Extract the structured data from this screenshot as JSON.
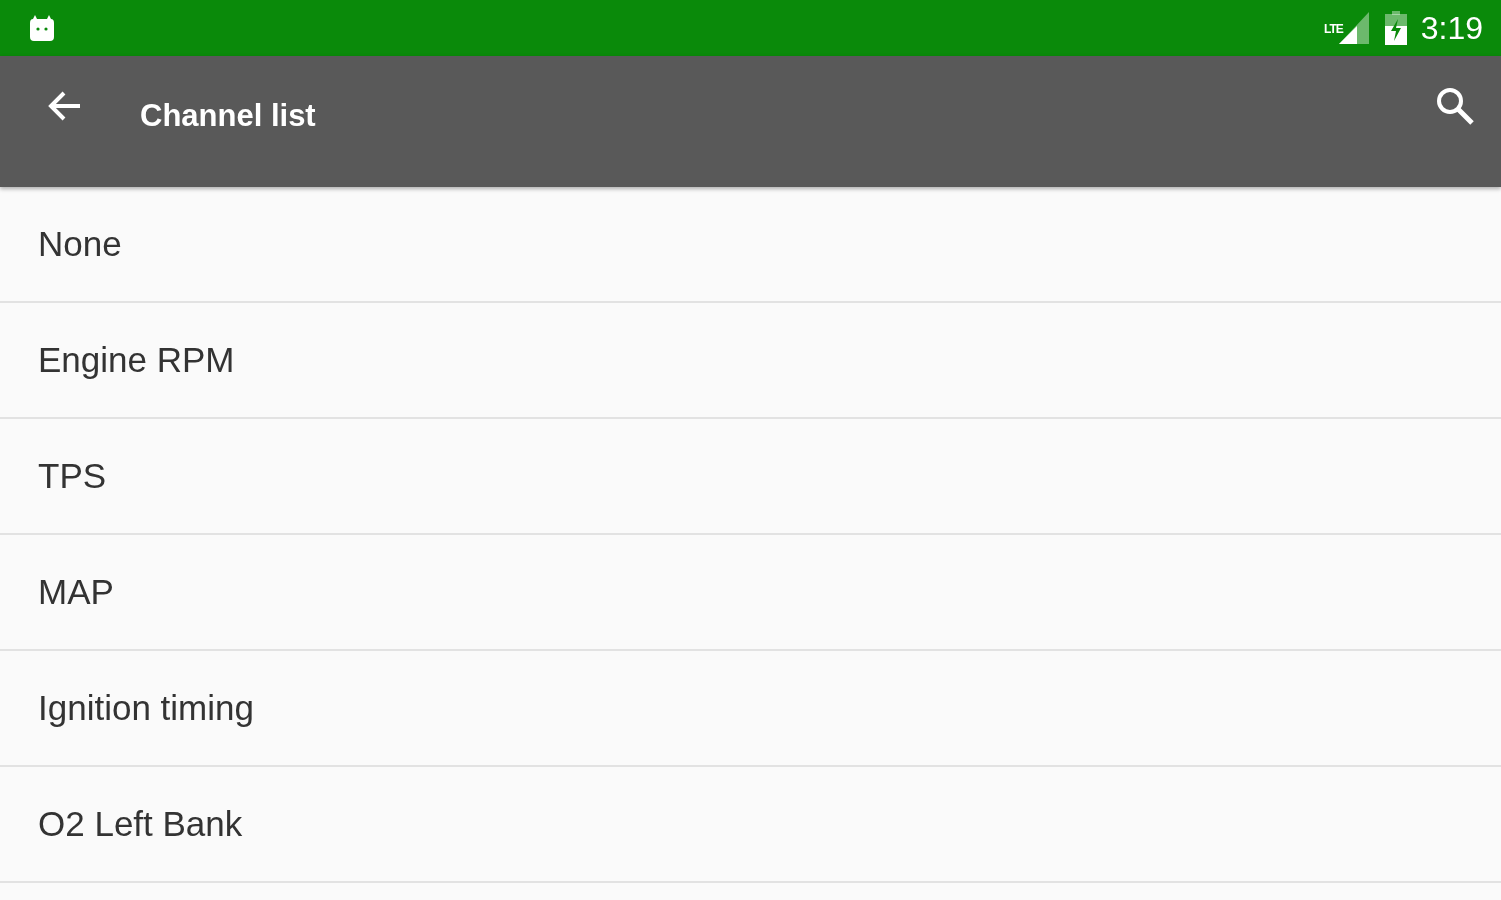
{
  "status_bar": {
    "network": "LTE",
    "time": "3:19"
  },
  "toolbar": {
    "title": "Channel list"
  },
  "items": [
    {
      "label": "None"
    },
    {
      "label": "Engine RPM"
    },
    {
      "label": "TPS"
    },
    {
      "label": "MAP"
    },
    {
      "label": "Ignition timing"
    },
    {
      "label": "O2 Left Bank"
    }
  ]
}
